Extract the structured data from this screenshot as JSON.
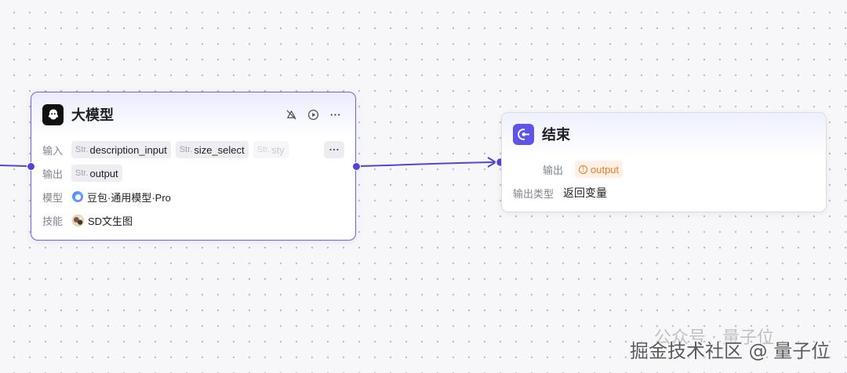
{
  "canvas": {
    "accent": "#5e55e8",
    "edge_color": "#4f46d6"
  },
  "llm_node": {
    "title": "大模型",
    "icon": "llm-ghost-icon",
    "actions": [
      "skip-icon",
      "run-icon",
      "more-icon"
    ],
    "input_label": "输入",
    "inputs": [
      {
        "type": "Str.",
        "name": "description_input"
      },
      {
        "type": "Str.",
        "name": "size_select"
      },
      {
        "type": "Str.",
        "name": "sty"
      }
    ],
    "output_label": "输出",
    "outputs": [
      {
        "type": "Str.",
        "name": "output"
      }
    ],
    "model_label": "模型",
    "model_value": "豆包·通用模型·Pro",
    "skill_label": "技能",
    "skill_value": "SD文生图"
  },
  "end_node": {
    "title": "结束",
    "icon": "end-node-icon",
    "output_label": "输出",
    "output_value": "output",
    "output_type_label": "输出类型",
    "output_type_value": "返回变量",
    "warning_color": "#ec7c21"
  },
  "watermark": {
    "line1": "公众号 · 量子位",
    "line2": "掘金技术社区 @ 量子位"
  }
}
